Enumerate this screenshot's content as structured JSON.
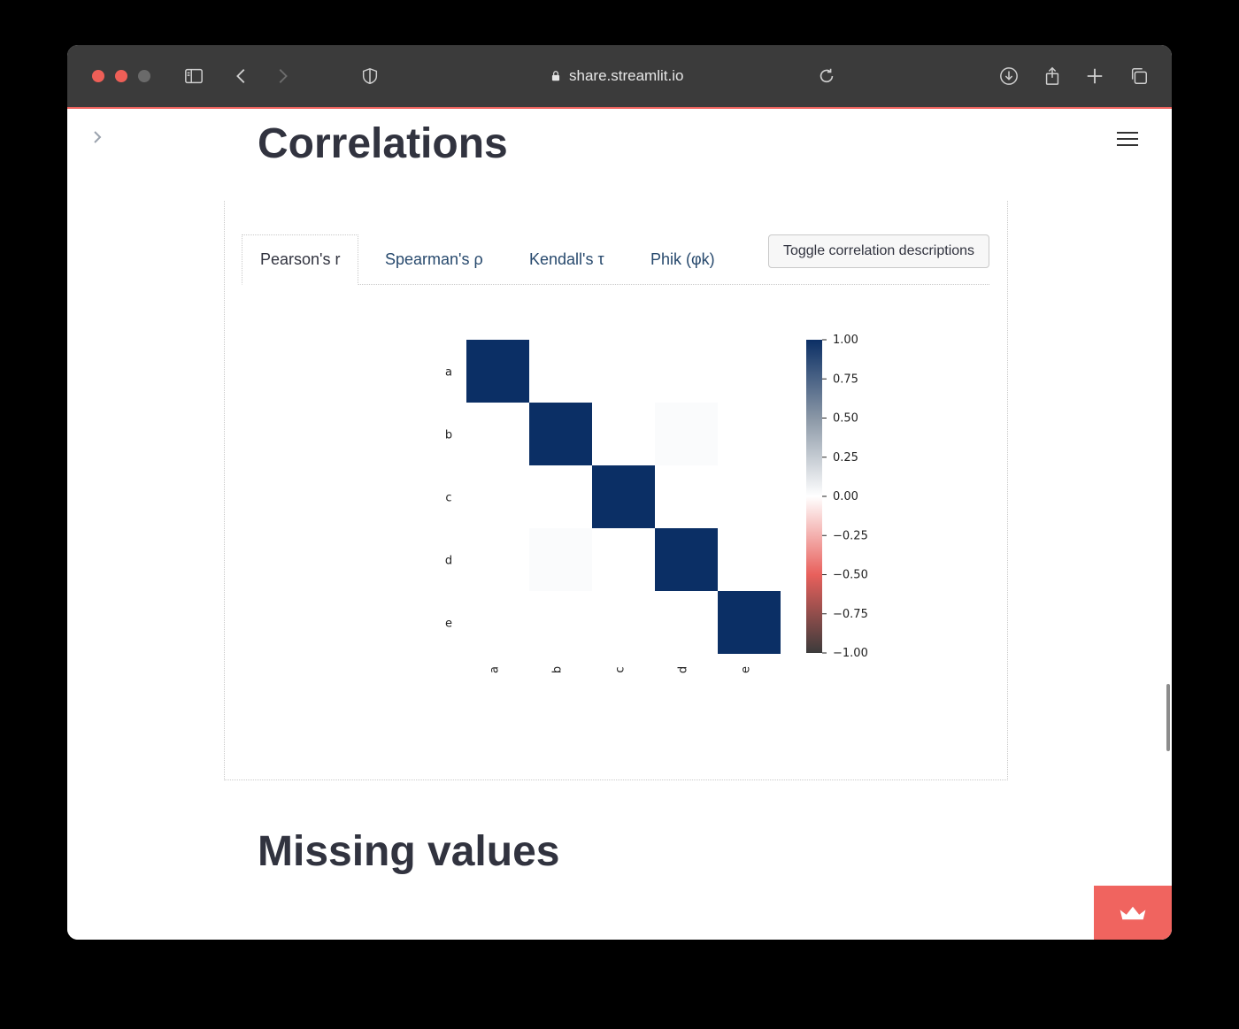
{
  "browser": {
    "url": "share.streamlit.io",
    "icons": [
      "sidebar-icon",
      "back-icon",
      "forward-icon",
      "shield-icon",
      "lock-icon",
      "reload-icon",
      "download-icon",
      "share-icon",
      "new-tab-icon",
      "tabs-overview-icon"
    ]
  },
  "page": {
    "section1_title": "Correlations",
    "section2_title": "Missing values"
  },
  "tabs": [
    {
      "label": "Pearson's r",
      "active": true
    },
    {
      "label": "Spearman's ρ",
      "active": false
    },
    {
      "label": "Kendall's τ",
      "active": false
    },
    {
      "label": "Phik (φk)",
      "active": false
    }
  ],
  "toggle_button": "Toggle correlation descriptions",
  "colors": {
    "accent": "#f0645f",
    "positive": "#0b2f65",
    "negative": "#e8605c",
    "text": "#31333f"
  },
  "chart_data": {
    "type": "heatmap",
    "title": "",
    "row_labels": [
      "a",
      "b",
      "c",
      "d",
      "e"
    ],
    "col_labels": [
      "a",
      "b",
      "c",
      "d",
      "e"
    ],
    "values": [
      [
        1,
        0,
        0,
        0,
        0
      ],
      [
        0,
        1,
        0,
        0.02,
        0
      ],
      [
        0,
        0,
        1,
        0,
        0
      ],
      [
        0,
        0.02,
        0,
        1,
        0
      ],
      [
        0,
        0,
        0,
        0,
        1
      ]
    ],
    "colorbar_range": [
      -1,
      1
    ],
    "colorbar_ticks": [
      "1.00",
      "0.75",
      "0.50",
      "0.25",
      "0.00",
      "−0.25",
      "−0.50",
      "−0.75",
      "−1.00"
    ],
    "legend_position": "right"
  }
}
